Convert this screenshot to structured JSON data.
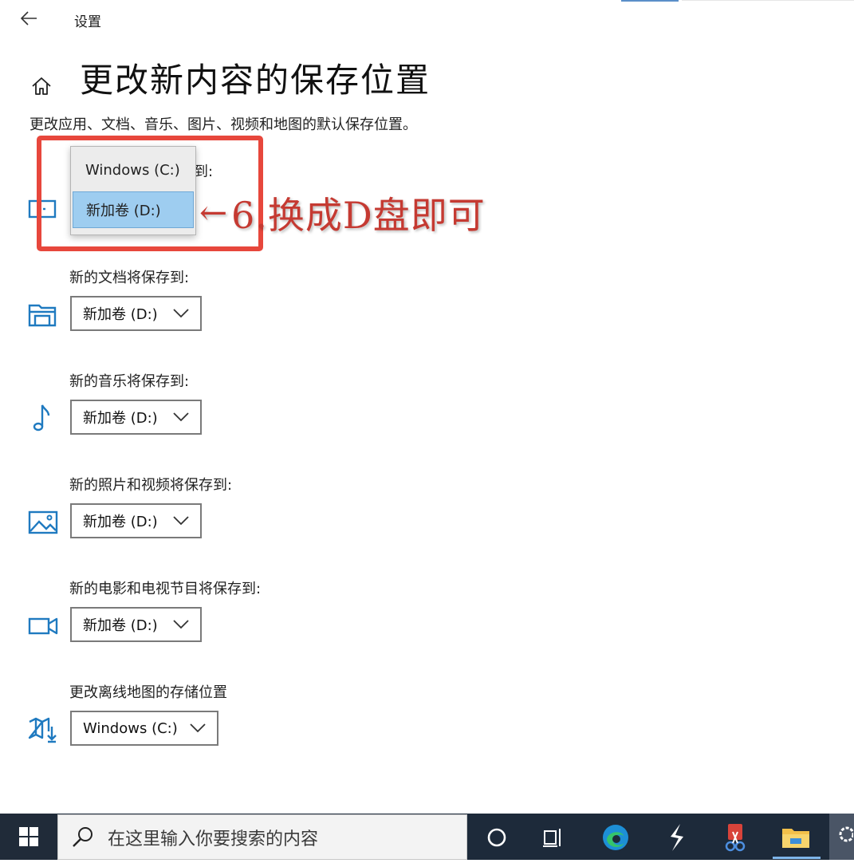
{
  "header": {
    "app_title": "设置"
  },
  "page": {
    "title": "更改新内容的保存位置",
    "description": "更改应用、文档、音乐、图片、视频和地图的默认保存位置。"
  },
  "apps_row": {
    "label_visible_tail": "到:",
    "popup_options": [
      "Windows (C:)",
      "新加卷 (D:)"
    ],
    "popup_selected": "新加卷 (D:)"
  },
  "rows": [
    {
      "label": "新的文档将保存到:",
      "value": "新加卷 (D:)",
      "icon": "documents-folder-icon"
    },
    {
      "label": "新的音乐将保存到:",
      "value": "新加卷 (D:)",
      "icon": "music-note-icon"
    },
    {
      "label": "新的照片和视频将保存到:",
      "value": "新加卷 (D:)",
      "icon": "picture-icon"
    },
    {
      "label": "新的电影和电视节目将保存到:",
      "value": "新加卷 (D:)",
      "icon": "video-camera-icon"
    },
    {
      "label": "更改离线地图的存储位置",
      "value": "Windows (C:)",
      "icon": "map-download-icon"
    }
  ],
  "annotation": {
    "arrow": "←",
    "text": "6.换成D盘即可"
  },
  "taskbar": {
    "search_placeholder": "在这里输入你要搜索的内容",
    "icons": [
      "cortana-icon",
      "task-view-icon",
      "edge-icon",
      "app-s-icon",
      "snip-tool-icon",
      "file-explorer-icon",
      "settings-gear-icon"
    ]
  },
  "colors": {
    "accent_icon": "#1f7ac0",
    "popup_selected": "#9ecdf0",
    "annotation_red": "#e7473c",
    "taskbar": "#1d2a3a"
  }
}
